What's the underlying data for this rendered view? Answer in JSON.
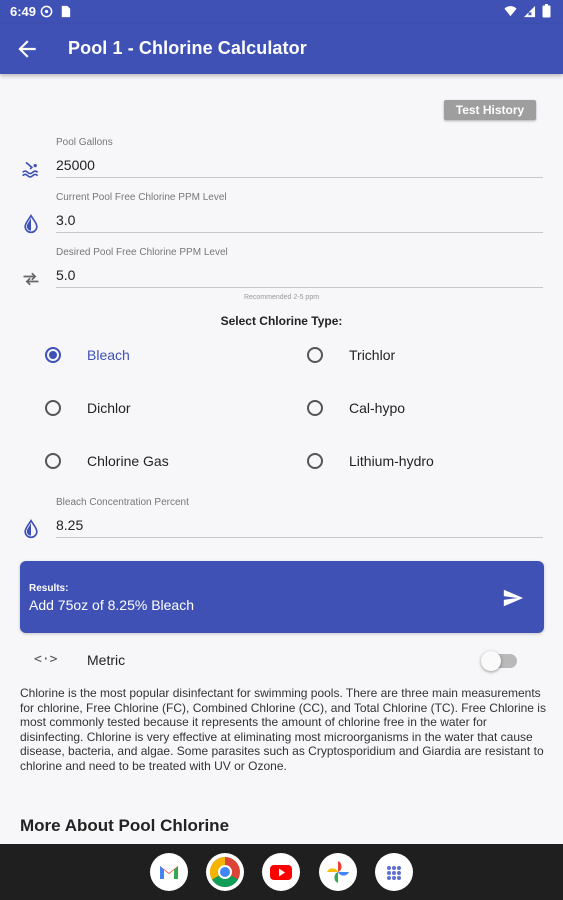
{
  "status_bar": {
    "time": "6:49"
  },
  "app_bar": {
    "title": "Pool 1 - Chlorine Calculator",
    "back_icon": "arrow-back-icon"
  },
  "history_button": "Test History",
  "fields": [
    {
      "label": "Pool Gallons",
      "value": "25000",
      "icon": "pool-icon"
    },
    {
      "label": "Current Pool Free Chlorine PPM Level",
      "value": "3.0",
      "icon": "water-drop-icon"
    },
    {
      "label": "Desired Pool Free Chlorine PPM Level",
      "value": "5.0",
      "icon": "swap-arrows-icon"
    }
  ],
  "hint": "Recommended 2-5 ppm",
  "chlorine_type": {
    "title": "Select Chlorine Type:",
    "options": [
      "Bleach",
      "Trichlor",
      "Dichlor",
      "Cal-hypo",
      "Chlorine Gas",
      "Lithium-hydro"
    ],
    "selected": "Bleach"
  },
  "concentration": {
    "label": "Bleach Concentration Percent",
    "value": "8.25",
    "icon": "water-drop-icon"
  },
  "results": {
    "label": "Results:",
    "value": "Add 75oz of 8.25% Bleach",
    "icon": "send-icon"
  },
  "metric": {
    "icon_text": "<·>",
    "label": "Metric",
    "enabled": false
  },
  "description": "Chlorine is the most popular disinfectant for swimming pools. There are three main measurements for chlorine, Free Chlorine (FC), Combined Chlorine (CC), and Total Chlorine (TC). Free Chlorine is most commonly tested because it represents the amount of chlorine free in the water for disinfecting. Chlorine is very effective at eliminating most microorganisms in the water that cause disease, bacteria, and algae. Some parasites such as Cryptosporidium and Giardia are resistant to chlorine and need to be treated with UV or Ozone.",
  "more_heading": "More About Pool Chlorine",
  "dock_apps": [
    "gmail-icon",
    "chrome-icon",
    "youtube-icon",
    "photos-icon",
    "app-drawer-icon"
  ],
  "colors": {
    "primary": "#3f51b5",
    "background": "#f7f7fa",
    "dock": "#1f1f1f"
  }
}
